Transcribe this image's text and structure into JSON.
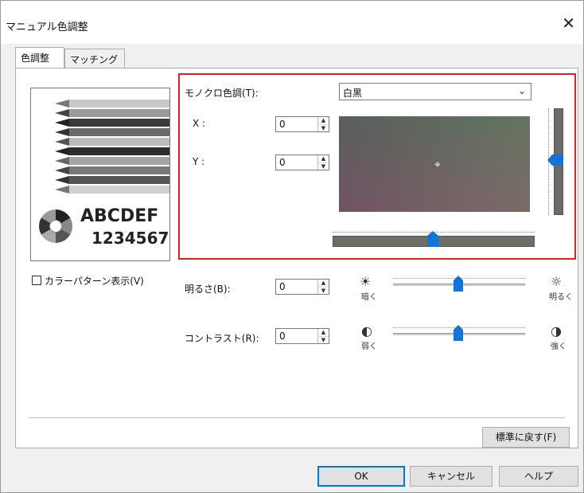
{
  "window": {
    "title": "マニュアル色調整",
    "close_glyph": "✕"
  },
  "tabs": [
    {
      "label": "色調整"
    },
    {
      "label": "マッチング"
    }
  ],
  "preview": {
    "line1": "ABCDEF",
    "line2": "1234567"
  },
  "color_pattern": {
    "label": "カラーパターン表示(V)",
    "checked": false
  },
  "tone": {
    "label": "モノクロ色調(T):",
    "selected": "白黒",
    "x_label": "X :",
    "x_value": "0",
    "y_label": "Y :",
    "y_value": "0"
  },
  "brightness": {
    "label": "明るさ(B):",
    "value": "0",
    "low_label": "暗く",
    "high_label": "明るく"
  },
  "contrast": {
    "label": "コントラスト(R):",
    "value": "0",
    "low_label": "弱く",
    "high_label": "強く"
  },
  "buttons": {
    "reset": "標準に戻す(F)",
    "ok": "OK",
    "cancel": "キャンセル",
    "help": "ヘルプ"
  },
  "colors": {
    "highlight_box": "#e02020",
    "slider_thumb": "#1174d8"
  },
  "icons": {
    "dropdown": "chevron-down-icon",
    "spin_up": "spin-up-icon",
    "spin_down": "spin-down-icon",
    "crosshair": "crosshair-icon",
    "brightness_low": "sun-dim-icon",
    "brightness_high": "sun-bright-icon",
    "contrast_low": "contrast-low-icon",
    "contrast_high": "contrast-high-icon"
  }
}
